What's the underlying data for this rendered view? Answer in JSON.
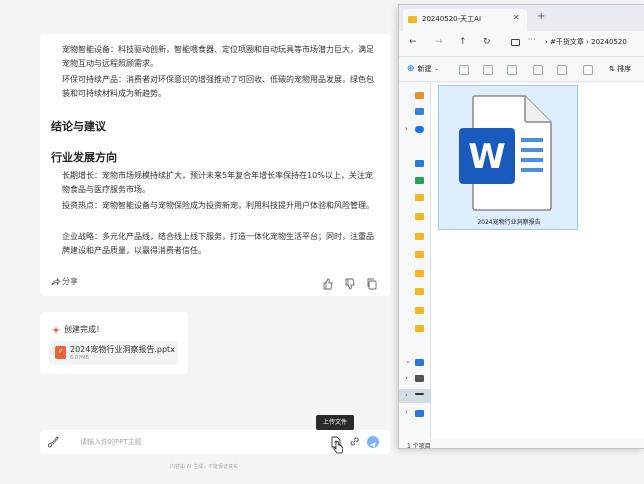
{
  "chat": {
    "paragraphs": [
      "宠物智能设备：科技驱动创新，智能喂食器、定位项圈和自动玩具等市场潜力巨大，满足宠物互动与远程照顾需求。",
      "环保可持续产品：消费者对环保意识的增强推动了可回收、低碳的宠物用品发展，绿色包装和可持续材料成为新趋势。"
    ],
    "heading1": "结论与建议",
    "heading2": "行业发展方向",
    "paragraphs2": [
      "长期增长：宠物市场规模持续扩大，预计未来5年复合年增长率保持在10%以上，关注宠物食品与医疗服务市场。",
      "投资热点：宠物智能设备与宠物保险成为投资新宠，利用科技提升用户体验和风险管理。",
      "企业战略：多元化产品线，结合线上线下服务，打造一体化宠物生活平台；同时，注重品牌建设和产品质量，以赢得消费者信任。"
    ],
    "share_label": "分享",
    "created_label": "创建完成！",
    "attachment": {
      "name": "2024宠物行业洞察报告.pptx",
      "size": "6.07MB"
    },
    "tooltip": "上传文件",
    "input_placeholder": "请输入你的PPT主题",
    "footer": "内容由 AI 生成，不能保证真实"
  },
  "explorer": {
    "tab_title": "20240520-天工AI",
    "breadcrumbs": "› #干货文章 › 20240520",
    "new_label": "新建",
    "sort_label": "排序",
    "file_name": "2024宠物行业洞察报告",
    "status": "1 个项目"
  },
  "colors": {
    "accent": "#1a73e8",
    "word_blue": "#185abd",
    "ppt_orange": "#e8643a"
  }
}
